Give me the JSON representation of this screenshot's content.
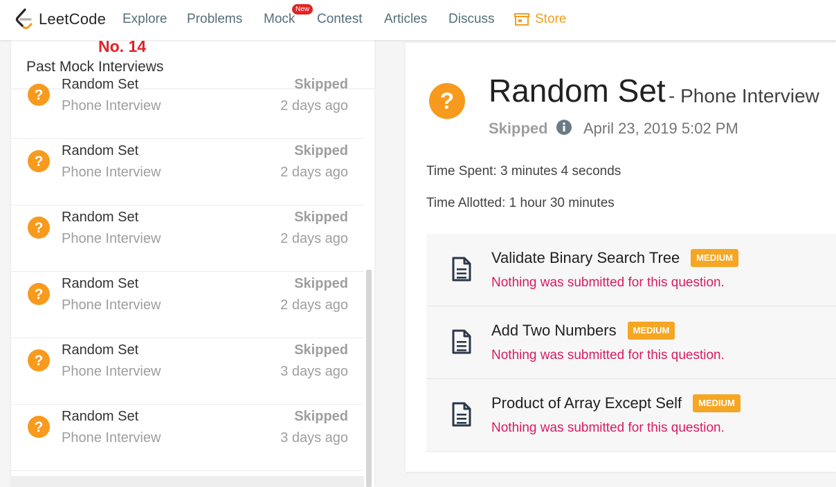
{
  "nav": {
    "logo": "LeetCode",
    "items": [
      {
        "label": "Explore"
      },
      {
        "label": "Problems"
      },
      {
        "label": "Mock"
      },
      {
        "label": "Contest"
      },
      {
        "label": "Articles"
      },
      {
        "label": "Discuss"
      }
    ],
    "new_badge": "New",
    "store": "Store",
    "accent": "#f0a020"
  },
  "annotation": "No. 14",
  "sidebar": {
    "title": "Past Mock Interviews",
    "items": [
      {
        "title": "Random Set",
        "subtitle": "Phone Interview",
        "status": "Skipped",
        "time": "2 days ago",
        "icon": "question-circle-icon"
      },
      {
        "title": "Random Set",
        "subtitle": "Phone Interview",
        "status": "Skipped",
        "time": "2 days ago",
        "icon": "question-circle-icon"
      },
      {
        "title": "Random Set",
        "subtitle": "Phone Interview",
        "status": "Skipped",
        "time": "2 days ago",
        "icon": "question-circle-icon"
      },
      {
        "title": "Random Set",
        "subtitle": "Phone Interview",
        "status": "Skipped",
        "time": "2 days ago",
        "icon": "question-circle-icon"
      },
      {
        "title": "Random Set",
        "subtitle": "Phone Interview",
        "status": "Skipped",
        "time": "3 days ago",
        "icon": "question-circle-icon"
      },
      {
        "title": "Random Set",
        "subtitle": "Phone Interview",
        "status": "Skipped",
        "time": "3 days ago",
        "icon": "question-circle-icon"
      }
    ]
  },
  "detail": {
    "title": "Random Set",
    "subtitle": "- Phone Interview",
    "status": "Skipped",
    "date": "April 23, 2019 5:02 PM",
    "time_spent": "Time Spent: 3 minutes 4 seconds",
    "time_allotted": "Time Allotted: 1 hour 30 minutes",
    "questions": [
      {
        "title": "Validate Binary Search Tree",
        "difficulty": "MEDIUM",
        "message": "Nothing was submitted for this question."
      },
      {
        "title": "Add Two Numbers",
        "difficulty": "MEDIUM",
        "message": "Nothing was submitted for this question."
      },
      {
        "title": "Product of Array Except Self",
        "difficulty": "MEDIUM",
        "message": "Nothing was submitted for this question."
      }
    ]
  },
  "colors": {
    "question_icon": "#f79a1e",
    "badge": "#f5a623",
    "message": "#d81b60",
    "annotation": "#e0222a"
  }
}
